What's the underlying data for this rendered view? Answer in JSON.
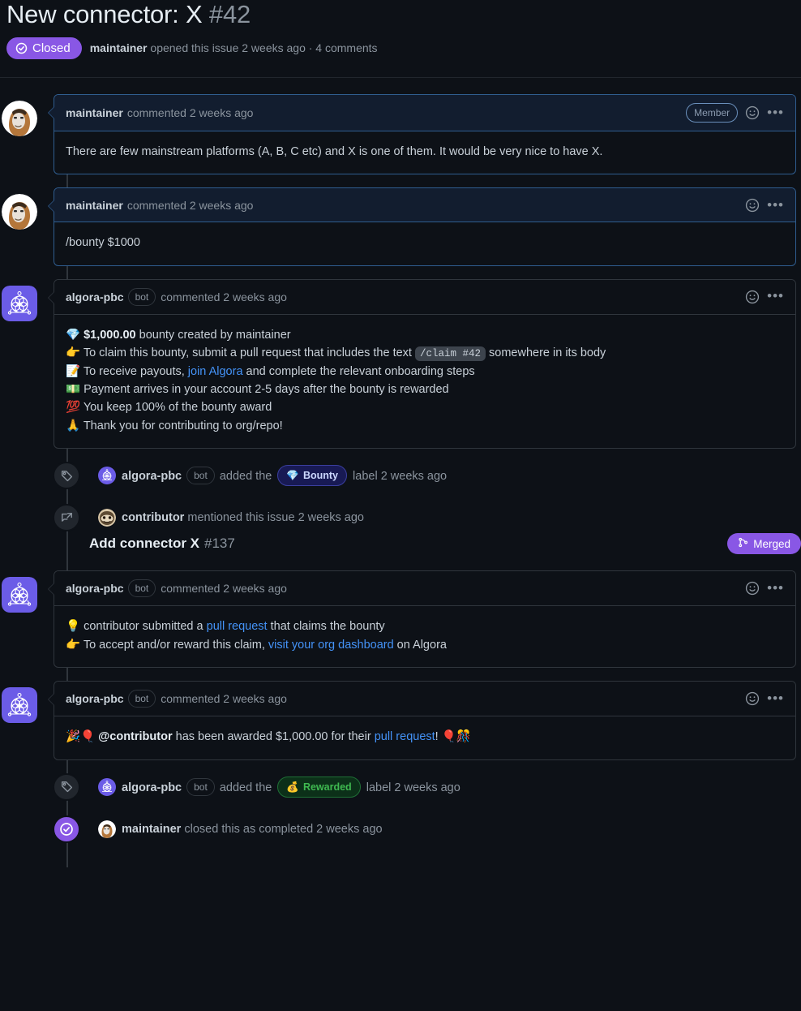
{
  "issue": {
    "title_text": "New connector: X",
    "number": "#42",
    "state_label": "Closed",
    "meta_author": "maintainer",
    "meta_rest": "opened this issue 2 weeks ago · 4 comments"
  },
  "comments": [
    {
      "author": "maintainer",
      "bot_tag": "",
      "head_rest": "commented 2 weeks ago",
      "role_badge": "Member",
      "style": "member",
      "avatar": "maintainer",
      "body_lines": [
        {
          "segments": [
            {
              "type": "text",
              "text": "There are few mainstream platforms (A, B, C etc) and X is one of them. It would be very nice to have X."
            }
          ]
        }
      ]
    },
    {
      "author": "maintainer",
      "bot_tag": "",
      "head_rest": "commented 2 weeks ago",
      "role_badge": "",
      "style": "member",
      "avatar": "maintainer",
      "body_lines": [
        {
          "segments": [
            {
              "type": "text",
              "text": "/bounty $1000"
            }
          ]
        }
      ]
    },
    {
      "author": "algora-pbc",
      "bot_tag": "bot",
      "head_rest": "commented 2 weeks ago",
      "role_badge": "",
      "style": "bot",
      "avatar": "algora",
      "body_lines": [
        {
          "segments": [
            {
              "type": "emoji",
              "text": "💎"
            },
            {
              "type": "bold",
              "text": " $1,000.00"
            },
            {
              "type": "text",
              "text": " bounty created by maintainer"
            }
          ]
        },
        {
          "segments": [
            {
              "type": "emoji",
              "text": "👉"
            },
            {
              "type": "text",
              "text": " To claim this bounty, submit a pull request that includes the text "
            },
            {
              "type": "code",
              "text": "/claim #42"
            },
            {
              "type": "text",
              "text": " somewhere in its body"
            }
          ]
        },
        {
          "segments": [
            {
              "type": "emoji",
              "text": "📝"
            },
            {
              "type": "text",
              "text": " To receive payouts, "
            },
            {
              "type": "link",
              "text": "join Algora"
            },
            {
              "type": "text",
              "text": " and complete the relevant onboarding steps"
            }
          ]
        },
        {
          "segments": [
            {
              "type": "emoji",
              "text": "💵"
            },
            {
              "type": "text",
              "text": " Payment arrives in your account 2-5 days after the bounty is rewarded"
            }
          ]
        },
        {
          "segments": [
            {
              "type": "emoji",
              "text": "💯"
            },
            {
              "type": "text",
              "text": " You keep 100% of the bounty award"
            }
          ]
        },
        {
          "segments": [
            {
              "type": "emoji",
              "text": "🙏"
            },
            {
              "type": "text",
              "text": " Thank you for contributing to org/repo!"
            }
          ]
        }
      ]
    }
  ],
  "events": {
    "label_bounty": {
      "icon": "tag-icon",
      "actor": "algora-pbc",
      "bot_tag": "bot",
      "pre_text": "added the",
      "label_emoji": "💎",
      "label_text": "Bounty",
      "post_text": "label 2 weeks ago"
    },
    "mentioned": {
      "icon": "cross-reference-icon",
      "actor": "contributor",
      "text": "mentioned this issue 2 weeks ago",
      "pr_title": "Add connector X",
      "pr_number": "#137",
      "pr_status": "Merged"
    },
    "label_rewarded": {
      "icon": "tag-icon",
      "actor": "algora-pbc",
      "bot_tag": "bot",
      "pre_text": "added the",
      "label_emoji": "💰",
      "label_text": "Rewarded",
      "post_text": "label 2 weeks ago"
    },
    "closed": {
      "icon": "closed-check-icon",
      "actor": "maintainer",
      "text": "closed this as completed 2 weeks ago"
    }
  },
  "bot_comment_claim": {
    "author": "algora-pbc",
    "bot_tag": "bot",
    "head_rest": "commented 2 weeks ago",
    "body_lines": [
      {
        "segments": [
          {
            "type": "emoji",
            "text": "💡"
          },
          {
            "type": "text",
            "text": " contributor submitted a "
          },
          {
            "type": "link",
            "text": "pull request"
          },
          {
            "type": "text",
            "text": " that claims the bounty"
          }
        ]
      },
      {
        "segments": [
          {
            "type": "emoji",
            "text": "👉"
          },
          {
            "type": "text",
            "text": " To accept and/or reward this claim, "
          },
          {
            "type": "link",
            "text": "visit your org dashboard"
          },
          {
            "type": "text",
            "text": " on Algora"
          }
        ]
      }
    ]
  },
  "bot_comment_award": {
    "author": "algora-pbc",
    "bot_tag": "bot",
    "head_rest": "commented 2 weeks ago",
    "body_lines": [
      {
        "segments": [
          {
            "type": "emoji",
            "text": "🎉🎈"
          },
          {
            "type": "bold",
            "text": " @contributor"
          },
          {
            "type": "text",
            "text": " has been awarded $1,000.00 for their "
          },
          {
            "type": "link",
            "text": "pull request"
          },
          {
            "type": "text",
            "text": "! "
          },
          {
            "type": "emoji",
            "text": "🎈🎊"
          }
        ]
      }
    ]
  },
  "colors": {
    "accent_purple": "#8957e5",
    "link_blue": "#4493f8",
    "green": "#3fb950",
    "member_border": "#2f5d8f",
    "member_head_bg": "#121d2f",
    "page_bg": "#0d1117"
  }
}
